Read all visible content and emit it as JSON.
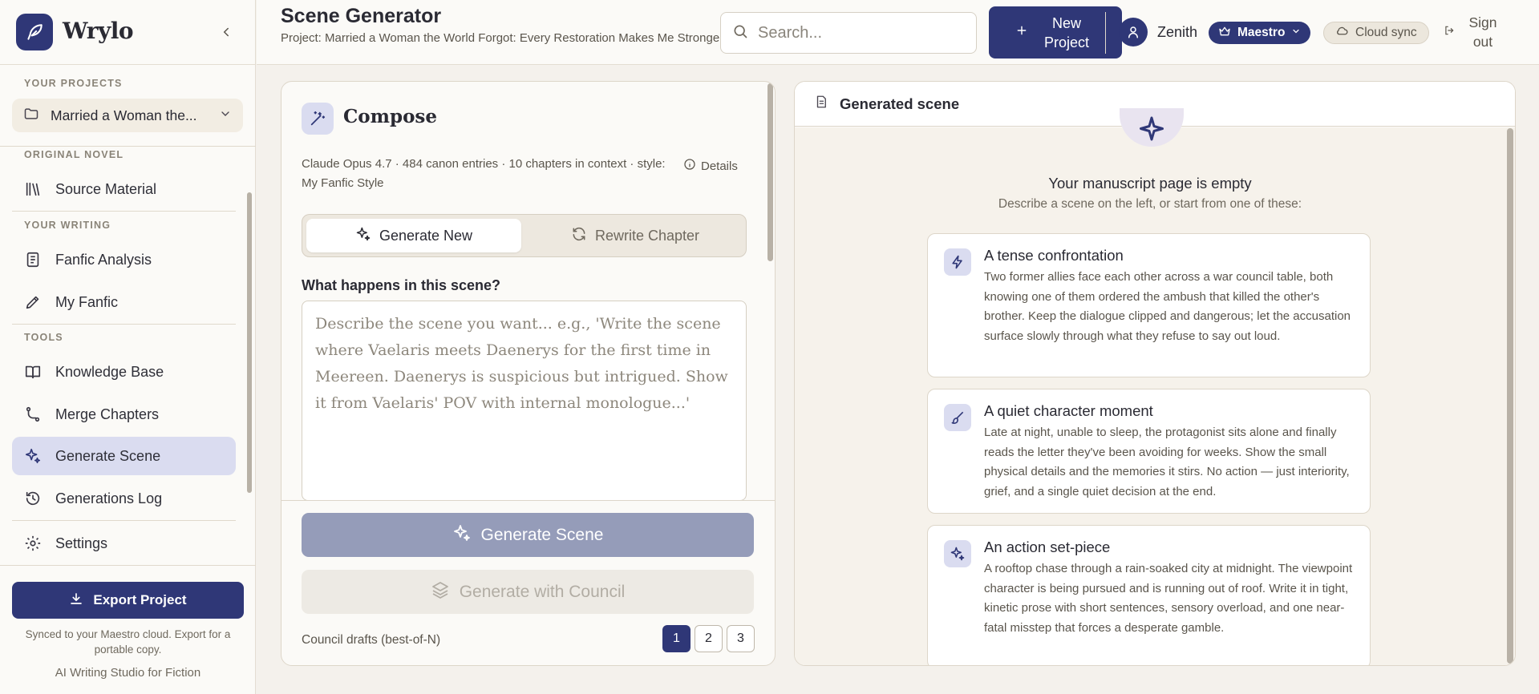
{
  "brand": {
    "name": "Wrylo"
  },
  "sidebar": {
    "projects_label": "YOUR PROJECTS",
    "project_selected": "Married a Woman the...",
    "sections": {
      "original": "ORIGINAL NOVEL",
      "writing": "YOUR WRITING",
      "tools": "TOOLS"
    },
    "items": [
      {
        "label": "Source Material",
        "icon": "library-icon"
      },
      {
        "label": "Fanfic Analysis",
        "icon": "document-icon"
      },
      {
        "label": "My Fanfic",
        "icon": "pen-icon"
      },
      {
        "label": "Knowledge Base",
        "icon": "book-icon"
      },
      {
        "label": "Merge Chapters",
        "icon": "merge-icon"
      },
      {
        "label": "Generate Scene",
        "icon": "sparkles-icon",
        "active": true
      },
      {
        "label": "Generations Log",
        "icon": "history-icon"
      },
      {
        "label": "Settings",
        "icon": "gear-icon"
      }
    ],
    "export_label": "Export Project",
    "synced_text": "Synced to your Maestro cloud. Export for a portable copy.",
    "tagline": "AI Writing Studio for Fiction"
  },
  "header": {
    "title": "Scene Generator",
    "subtitle": "Project: Married a Woman the World Forgot: Every Restoration Makes Me Stronger",
    "search_placeholder": "Search...",
    "new_project": "New Project",
    "user_name": "Zenith",
    "plan": "Maestro",
    "cloud": "Cloud sync",
    "signout": "Sign out"
  },
  "compose": {
    "title": "Compose",
    "meta": "Claude Opus 4.7 · 484 canon entries · 10 chapters in context · style: My Fanfic Style",
    "details": "Details",
    "tab_new": "Generate New",
    "tab_rewrite": "Rewrite Chapter",
    "question": "What happens in this scene?",
    "placeholder": "Describe the scene you want... e.g., 'Write the scene where Vaelaris meets Daenerys for the first time in Meereen. Daenerys is suspicious but intrigued. Show it from Vaelaris' POV with internal monologue...'",
    "generate": "Generate Scene",
    "generate_council": "Generate with Council",
    "drafts_label": "Council drafts (best-of-N)",
    "drafts": [
      "1",
      "2",
      "3"
    ],
    "drafts_selected": "1"
  },
  "generated": {
    "title": "Generated scene",
    "empty_title": "Your manuscript page is empty",
    "empty_sub": "Describe a scene on the left, or start from one of these:",
    "ideas": [
      {
        "title": "A tense confrontation",
        "desc": "Two former allies face each other across a war council table, both knowing one of them ordered the ambush that killed the other's brother. Keep the dialogue clipped and dangerous; let the accusation surface slowly through what they refuse to say out loud.",
        "icon": "bolt-icon"
      },
      {
        "title": "A quiet character moment",
        "desc": "Late at night, unable to sleep, the protagonist sits alone and finally reads the letter they've been avoiding for weeks. Show the small physical details and the memories it stirs. No action — just interiority, grief, and a single quiet decision at the end.",
        "icon": "brush-icon"
      },
      {
        "title": "An action set-piece",
        "desc": "A rooftop chase through a rain-soaked city at midnight. The viewpoint character is being pursued and is running out of roof. Write it in tight, kinetic prose with short sentences, sensory overload, and one near-fatal misstep that forces a desperate gamble.",
        "icon": "sparkles-icon"
      }
    ]
  },
  "colors": {
    "accent": "#2f3777",
    "active_nav": "#dadcf0",
    "disabled_button": "#959cb9",
    "background": "#f4f1ec"
  }
}
